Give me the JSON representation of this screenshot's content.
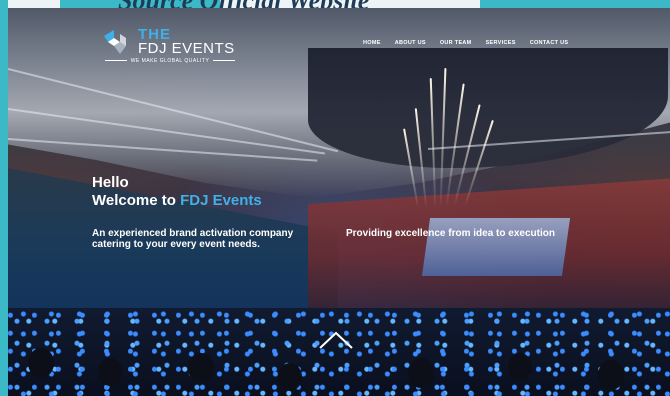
{
  "page_title": {
    "text": "Source Official Website",
    "accent": "Website"
  },
  "logo": {
    "line1": "THE",
    "line2": "FDJ EVENTS",
    "tagline": "WE MAKE GLOBAL QUALITY"
  },
  "nav": {
    "items": [
      {
        "label": "HOME"
      },
      {
        "label": "ABOUT US"
      },
      {
        "label": "OUR TEAM"
      },
      {
        "label": "SERVICES"
      },
      {
        "label": "CONTACT US"
      }
    ]
  },
  "hero": {
    "greeting": "Hello",
    "welcome_prefix": "Welcome to ",
    "welcome_brand": "FDJ Events",
    "left_text": "An experienced brand activation company catering to your every event needs.",
    "right_text": "Providing excellence from idea to execution"
  },
  "icons": {
    "logo_mark": "fdj-logo-icon",
    "scroll": "chevron-up-icon"
  },
  "colors": {
    "accent": "#3fb0e8",
    "page_stripe": "#27b2c2",
    "text": "#ffffff"
  }
}
